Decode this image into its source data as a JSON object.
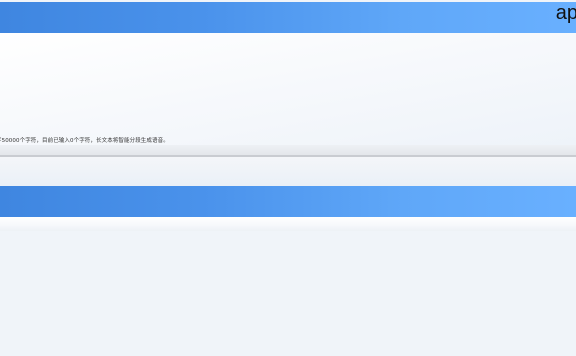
{
  "header": {
    "corner_text": "ap"
  },
  "editor": {
    "hint": "字50000个字符，目前已输入0个字符，长文本将智能分段生成语音。"
  },
  "colors": {
    "accent_bar_left": "#3f86e0",
    "accent_bar_right": "#69b0ff",
    "page_background": "#f0f4f9"
  }
}
